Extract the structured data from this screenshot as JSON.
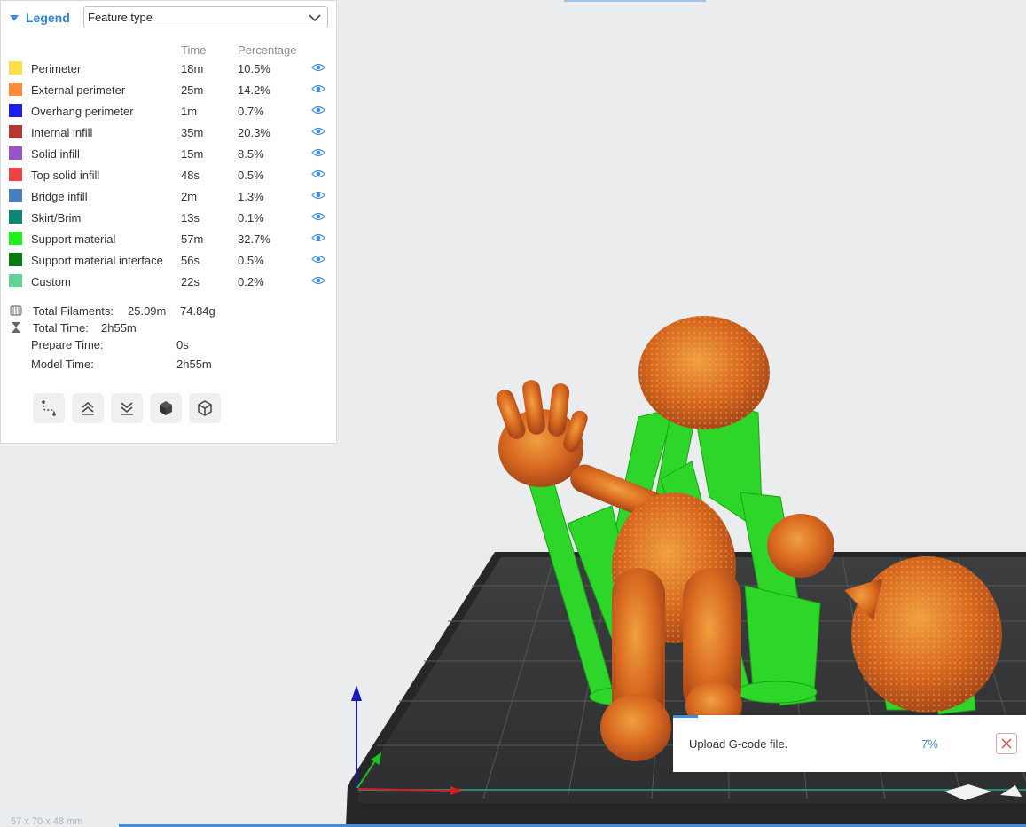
{
  "legend": {
    "title": "Legend",
    "view_type": "Feature type",
    "columns": {
      "time": "Time",
      "percentage": "Percentage"
    },
    "rows": [
      {
        "name": "Perimeter",
        "time": "18m",
        "pct": "10.5%",
        "color": "#ffe04a"
      },
      {
        "name": "External perimeter",
        "time": "25m",
        "pct": "14.2%",
        "color": "#ff8c3a"
      },
      {
        "name": "Overhang perimeter",
        "time": "1m",
        "pct": "0.7%",
        "color": "#1e1ee6"
      },
      {
        "name": "Internal infill",
        "time": "35m",
        "pct": "20.3%",
        "color": "#b33a33"
      },
      {
        "name": "Solid infill",
        "time": "15m",
        "pct": "8.5%",
        "color": "#9656c8"
      },
      {
        "name": "Top solid infill",
        "time": "48s",
        "pct": "0.5%",
        "color": "#ef4343"
      },
      {
        "name": "Bridge infill",
        "time": "2m",
        "pct": "1.3%",
        "color": "#4a7fbf"
      },
      {
        "name": "Skirt/Brim",
        "time": "13s",
        "pct": "0.1%",
        "color": "#0e8675"
      },
      {
        "name": "Support material",
        "time": "57m",
        "pct": "32.7%",
        "color": "#22ee22"
      },
      {
        "name": "Support material interface",
        "time": "56s",
        "pct": "0.5%",
        "color": "#0a7a12"
      },
      {
        "name": "Custom",
        "time": "22s",
        "pct": "0.2%",
        "color": "#62d49a"
      }
    ],
    "stats": {
      "filaments_label": "Total Filaments:",
      "filaments_length": "25.09m",
      "filaments_weight": "74.84g",
      "total_time_label": "Total Time:",
      "total_time": "2h55m",
      "prepare_label": "Prepare Time:",
      "prepare_time": "0s",
      "model_label": "Model Time:",
      "model_time": "2h55m"
    },
    "toolbar": [
      {
        "name": "travel-path-icon"
      },
      {
        "name": "move-up-icon"
      },
      {
        "name": "move-down-icon"
      },
      {
        "name": "solid-cube-icon"
      },
      {
        "name": "wireframe-cube-icon"
      }
    ]
  },
  "notification": {
    "message": "Upload G-code file.",
    "progress": "7%",
    "progress_fraction": 0.07
  },
  "status": {
    "dimensions": "57 x 70 x 48 mm"
  },
  "colors": {
    "accent": "#3f8de0",
    "model": "#d86a25",
    "support": "#2fd62a",
    "bed": "#3a3b3d"
  }
}
